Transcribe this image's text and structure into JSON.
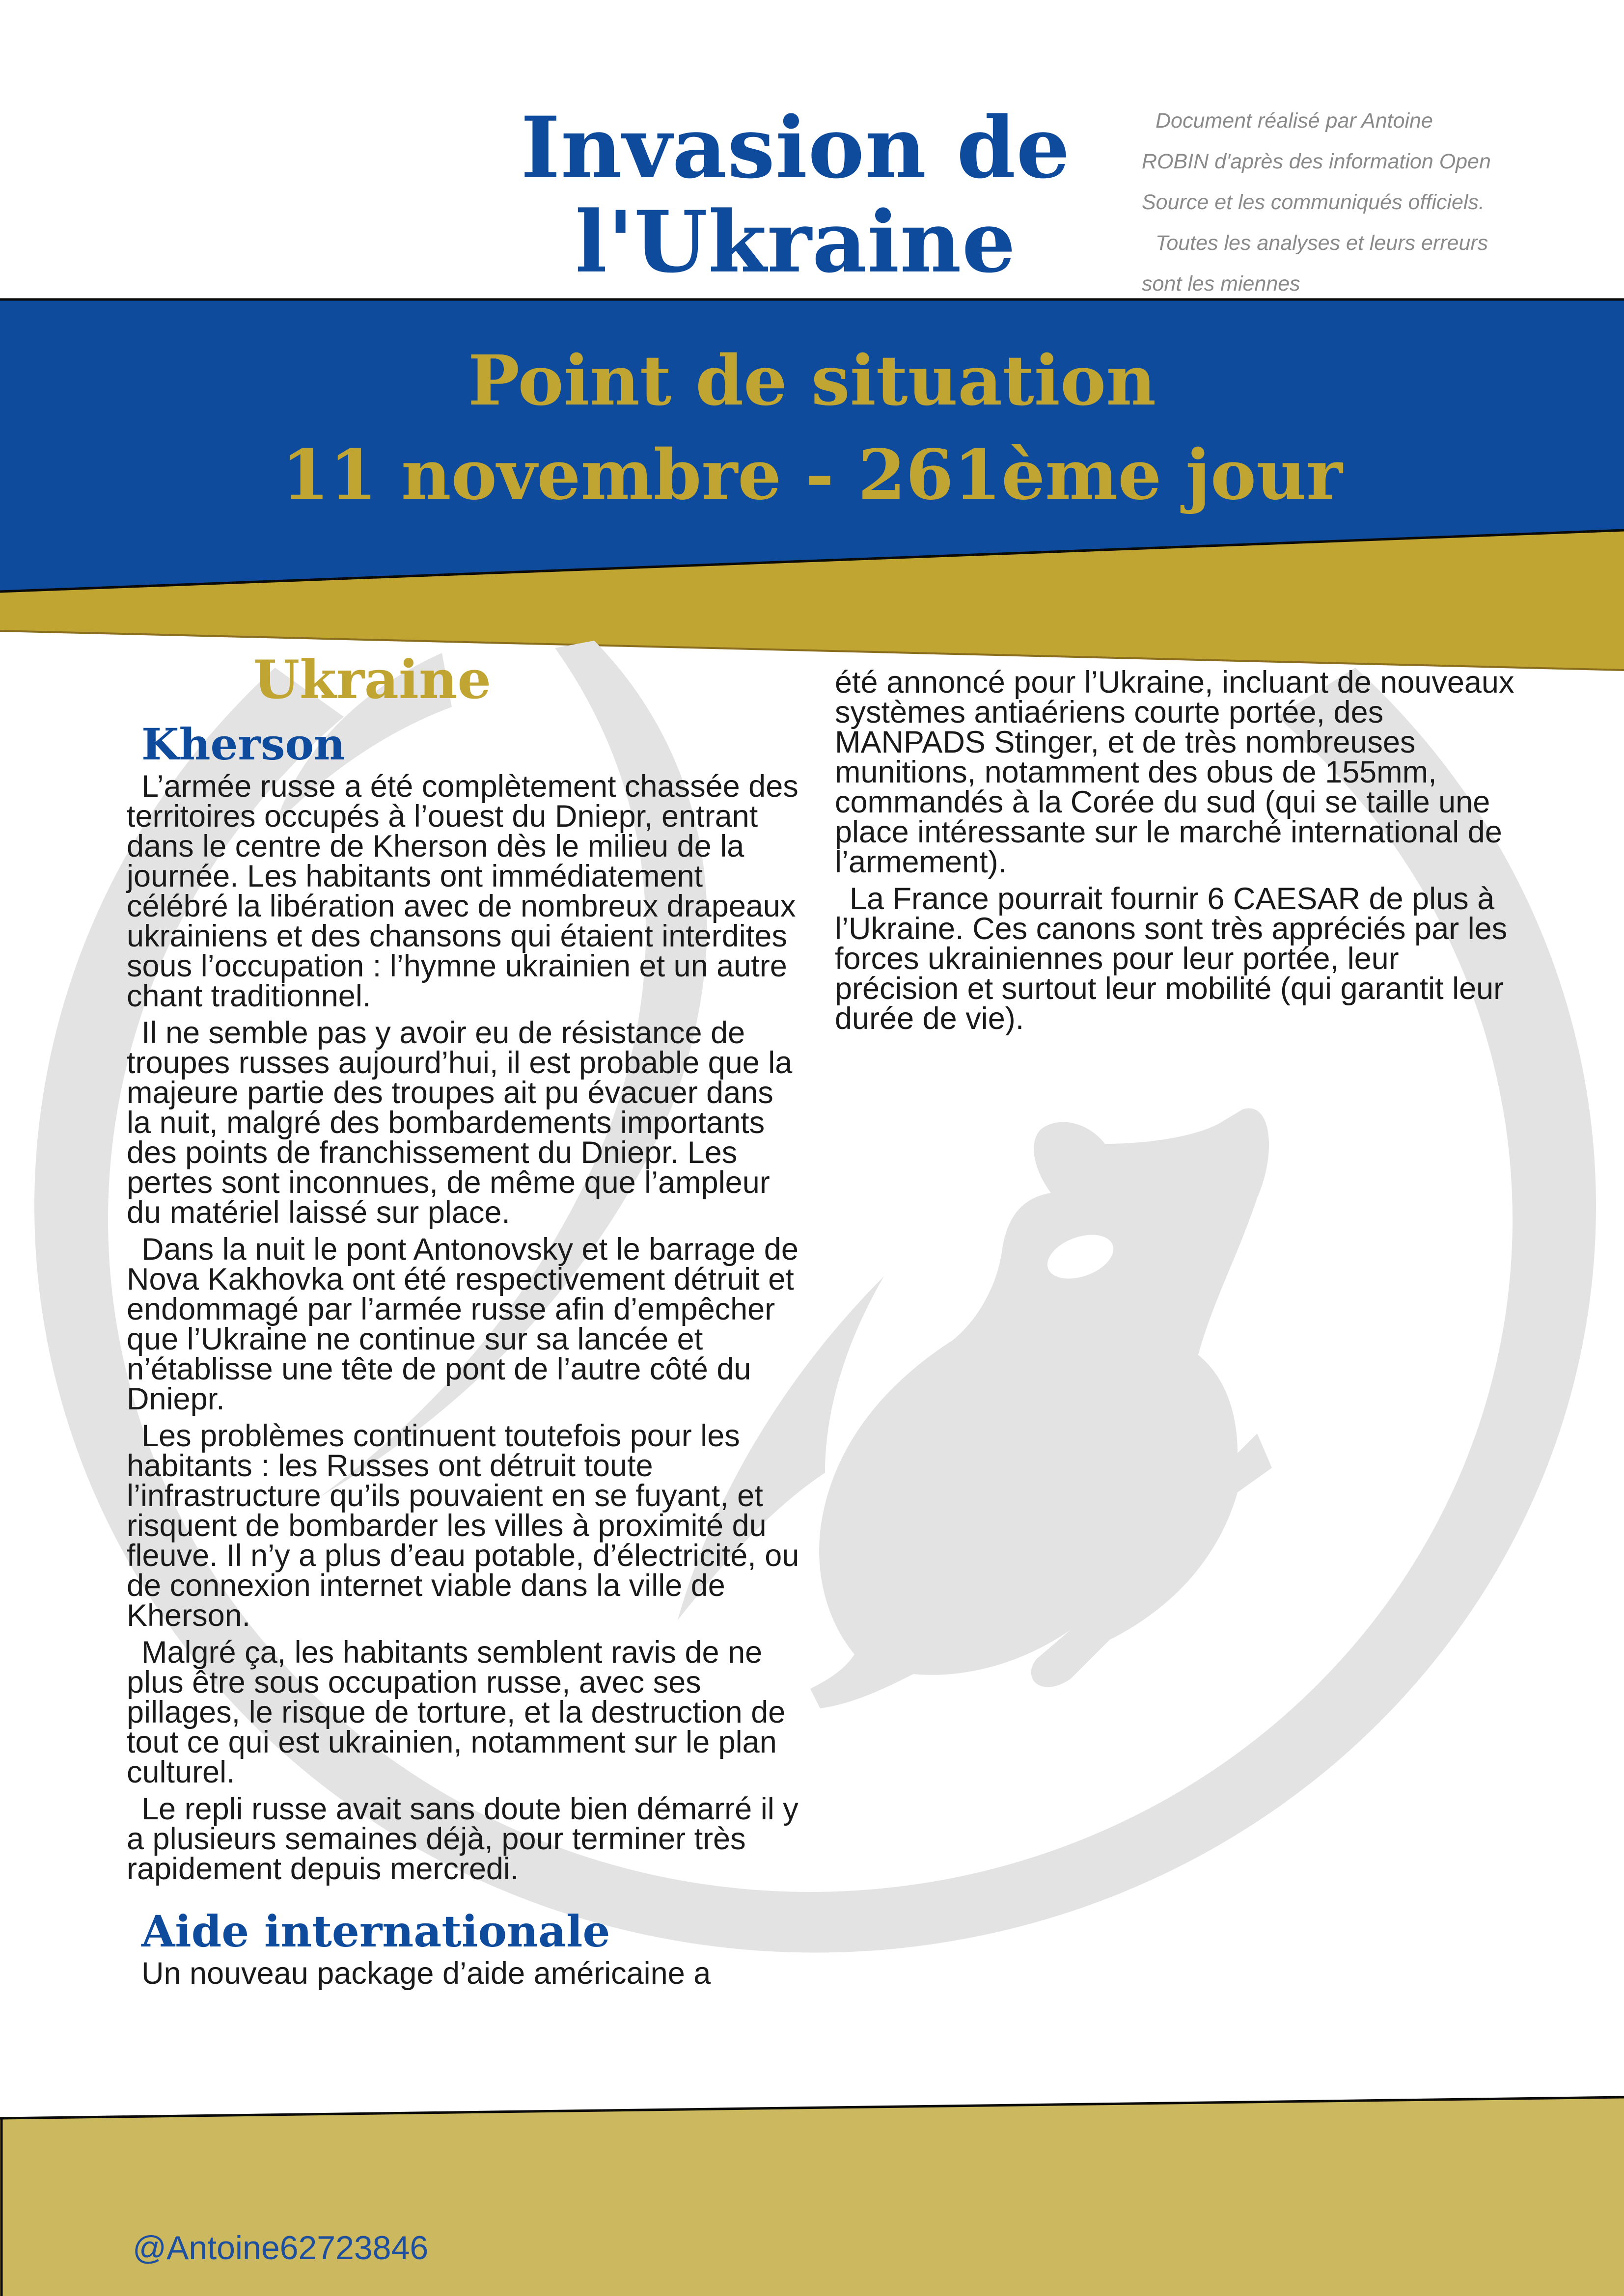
{
  "header": {
    "title_line1": "Invasion de",
    "title_line2": "l'Ukraine",
    "author_line1": "Document réalisé par Antoine",
    "author_line2": "ROBIN d'après des information Open",
    "author_line3": "Source et les communiqués officiels.",
    "author_line4": "Toutes les analyses et leurs erreurs",
    "author_line5": "sont les miennes"
  },
  "banner": {
    "line1": "Point de situation",
    "line2": "11 novembre - 261ème jour"
  },
  "colors": {
    "blue": "#0e4b9c",
    "gold": "#c1a532",
    "footer_gold": "#ccb85e",
    "watermark_grey": "#e3e3e3"
  },
  "icons": [
    "rat-watermark-icon"
  ],
  "content": {
    "region_heading": "Ukraine",
    "kherson_heading": "Kherson",
    "kherson_paragraphs": [
      "L’armée russe a été complètement chassée des territoires occupés à l’ouest du Dniepr, entrant dans le centre de Kherson dès le milieu de la journée. Les habitants ont immédiatement célébré la libération avec de nombreux drapeaux ukrainiens et des chansons qui étaient interdites sous l’occupation : l’hymne ukrainien et un autre chant traditionnel.",
      "Il ne semble pas y avoir eu de résistance de troupes russes aujourd’hui, il est probable que la majeure partie des troupes ait pu évacuer dans la nuit, malgré des bombardements importants des points de franchissement du Dniepr. Les pertes sont inconnues, de même que l’ampleur du matériel laissé sur place.",
      "Dans la nuit le pont Antonovsky et le barrage de Nova Kakhovka ont été respectivement détruit et endommagé par l’armée russe afin d’empêcher que l’Ukraine ne continue sur sa lancée et n’établisse une tête de pont de l’autre côté du Dniepr.",
      "Les problèmes continuent toutefois pour les habitants : les Russes ont détruit toute l’infrastructure qu’ils pouvaient en se fuyant, et risquent de bombarder les villes à proximité du fleuve. Il n’y a plus d’eau potable, d’électricité, ou de connexion internet viable dans la ville de Kherson.",
      "Malgré ça, les habitants semblent ravis de ne plus être sous occupation russe, avec ses pillages, le risque de torture, et la destruction de tout ce qui est ukrainien, notamment sur le plan culturel.",
      "Le repli russe avait sans doute bien démarré il y a plusieurs semaines déjà, pour terminer très rapidement depuis mercredi."
    ],
    "aide_heading": "Aide internationale",
    "aide_start": "Un nouveau package d’aide américaine a",
    "right_paragraphs": [
      "été annoncé pour l’Ukraine, incluant de nouveaux systèmes antiaériens courte portée, des MANPADS Stinger, et de très nombreuses munitions, notamment des obus de 155mm, commandés à la Corée du sud (qui se taille une place intéressante sur le marché international de l’armement).",
      "La France pourrait fournir 6 CAESAR de plus à l’Ukraine. Ces canons sont très appréciés par les forces ukrainiennes pour leur portée, leur précision et surtout leur mobilité (qui garantit leur durée de vie)."
    ]
  },
  "footer": {
    "handle": "@Antoine62723846"
  }
}
